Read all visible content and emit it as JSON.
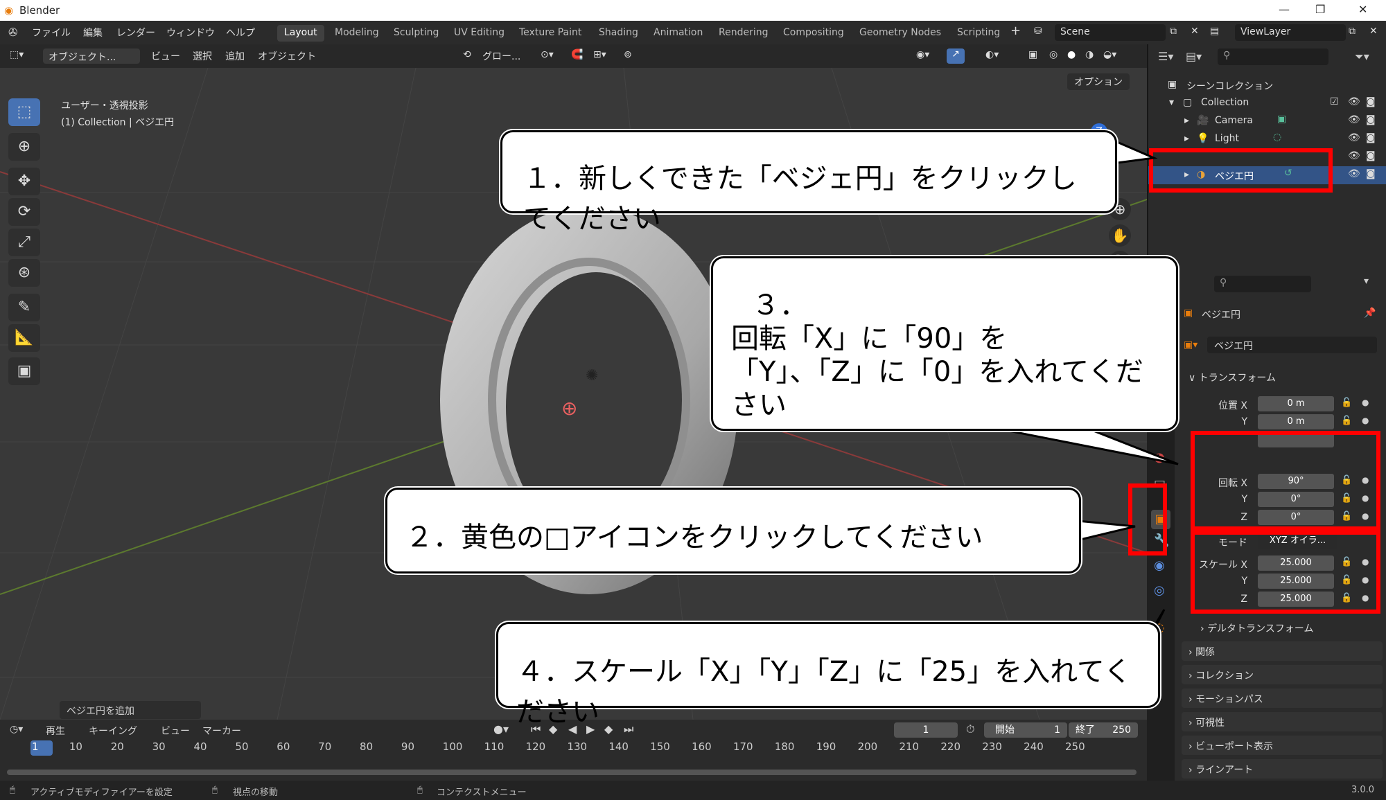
{
  "window": {
    "title": "Blender",
    "min_glyph": "—",
    "max_glyph": "❐",
    "close_glyph": "✕"
  },
  "menu": {
    "file": "ファイル",
    "edit": "編集",
    "render": "レンダー",
    "window": "ウィンドウ",
    "help": "ヘルプ"
  },
  "workspaces": [
    "Layout",
    "Modeling",
    "Sculpting",
    "UV Editing",
    "Texture Paint",
    "Shading",
    "Animation",
    "Rendering",
    "Compositing",
    "Geometry Nodes",
    "Scripting"
  ],
  "active_workspace": "Layout",
  "scene": {
    "label": "Scene",
    "view_layer": "ViewLayer"
  },
  "viewport_header": {
    "mode": "オブジェクト...",
    "view": "ビュー",
    "select": "選択",
    "add": "追加",
    "object": "オブジェクト",
    "orientation": "グロー...",
    "options": "オプション"
  },
  "viewport": {
    "view_name": "ユーザー・透視投影",
    "collection_line": "(1) Collection | ベジエ円",
    "operator_panel": "ベジエ円を追加"
  },
  "outliner": {
    "scene_collection": "シーンコレクション",
    "items": [
      {
        "label": "Collection"
      },
      {
        "label": "Camera"
      },
      {
        "label": "Light"
      },
      {
        "label": "ベジエ円"
      }
    ]
  },
  "properties": {
    "object_name": "ベジエ円",
    "data_name": "ベジエ円",
    "transform_label": "トランスフォーム",
    "location": {
      "label_x": "位置 X",
      "label_y": "Y",
      "x": "0 m",
      "y": "0 m"
    },
    "rotation": {
      "label_x": "回転 X",
      "label_y": "Y",
      "label_z": "Z",
      "x": "90°",
      "y": "0°",
      "z": "0°"
    },
    "mode": {
      "label": "モード",
      "value": "XYZ オイラ..."
    },
    "scale": {
      "label_x": "スケール X",
      "label_y": "Y",
      "label_z": "Z",
      "x": "25.000",
      "y": "25.000",
      "z": "25.000"
    },
    "panels": [
      "デルタトランスフォーム",
      "関係",
      "コレクション",
      "モーションパス",
      "可視性",
      "ビューポート表示",
      "ラインアート"
    ]
  },
  "timeline": {
    "playback": "再生",
    "keying": "キーイング",
    "view": "ビュー",
    "marker": "マーカー",
    "current_frame": "1",
    "start_label": "開始",
    "start": "1",
    "end_label": "終了",
    "end": "250",
    "frames": [
      "1",
      "10",
      "20",
      "30",
      "40",
      "50",
      "60",
      "70",
      "80",
      "90",
      "100",
      "110",
      "120",
      "130",
      "140",
      "150",
      "160",
      "170",
      "180",
      "190",
      "200",
      "210",
      "220",
      "230",
      "240",
      "250"
    ]
  },
  "statusbar": {
    "left": "アクティブモディファイアーを設定",
    "middle": "視点の移動",
    "right": "コンテクストメニュー",
    "version": "3.0.0"
  },
  "callouts": {
    "c1": "１．新しくできた「ベジェ円」をクリックしてください",
    "c2": "２．黄色の□アイコンをクリックしてください",
    "c3_line1": "３．",
    "c3_line2": "回転「X」に「90」を",
    "c3_line3": "「Y」、「Z」に「0」を入れてください",
    "c4": "４．スケール「X」「Y」「Z」に「25」を入れてください"
  },
  "colors": {
    "accent": "#4772b3",
    "highlight_red": "#ff0000",
    "object_orange": "#e87d0d"
  }
}
